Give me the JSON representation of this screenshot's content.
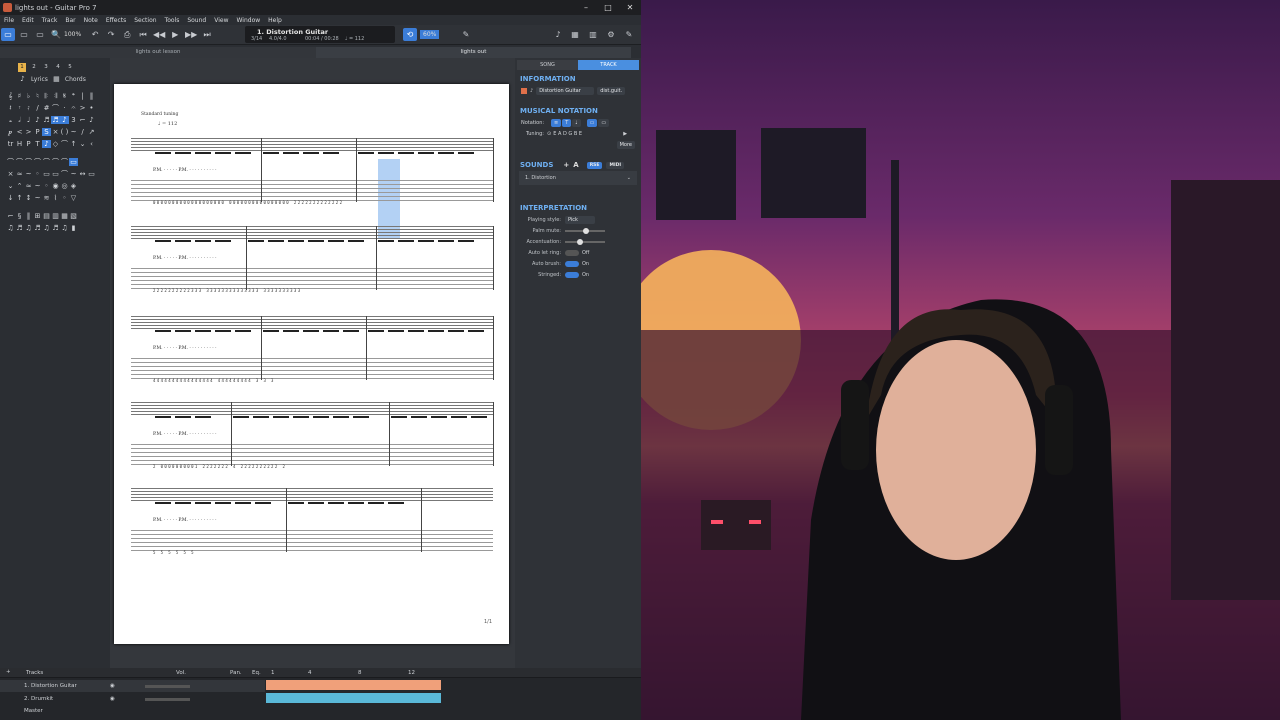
{
  "window": {
    "title": "lights out - Guitar Pro 7",
    "controls": [
      "–",
      "□",
      "✕"
    ]
  },
  "menu": [
    "File",
    "Edit",
    "Track",
    "Bar",
    "Note",
    "Effects",
    "Section",
    "Tools",
    "Sound",
    "View",
    "Window",
    "Help"
  ],
  "toolbar": {
    "zoom": "100%",
    "track_name": "1. Distortion Guitar",
    "bar_pos": "3/14",
    "sig": "4.0/4.0",
    "time": "00:04 / 00:28",
    "tempo": "♩ = 112",
    "countin": "60%"
  },
  "tabs": {
    "left": "lights out lesson",
    "right": "lights out"
  },
  "palette": {
    "numbers": [
      "1",
      "2",
      "3",
      "4",
      "5"
    ],
    "lyrics": "Lyrics",
    "chords": "Chords"
  },
  "score": {
    "tuning": "Standard tuning",
    "tempo": "♩ = 112",
    "page_number": "1/1",
    "track_abbrev": "dist.guit."
  },
  "right": {
    "tabs": [
      "SONG",
      "TRACK"
    ],
    "information": "INFORMATION",
    "track_label": "Distortion Guitar",
    "track_short": "dist.guit.",
    "notation_title": "MUSICAL NOTATION",
    "notation_label": "Notation:",
    "tuning_label": "Tuning:",
    "tuning_value": "E A D G B E",
    "more": "More",
    "sounds_title": "SOUNDS",
    "sounds_btns": [
      "RSE",
      "MIDI"
    ],
    "sound_item": "1. Distortion",
    "interp_title": "INTERPRETATION",
    "playing_style_label": "Playing style:",
    "playing_style": "Pick",
    "palm_mute": "Palm mute:",
    "accentuation": "Accentuation:",
    "auto_let_ring": "Auto let ring:",
    "auto_let_ring_val": "Off",
    "auto_brush": "Auto brush:",
    "auto_brush_val": "On",
    "stringed": "Stringed:",
    "stringed_val": "On"
  },
  "tracks": {
    "header": "Tracks",
    "vol": "Vol.",
    "pan": "Pan.",
    "eq": "Eq.",
    "markers": [
      "1",
      "4",
      "8",
      "12"
    ],
    "rows": [
      "1. Distortion Guitar",
      "2. Drumkit",
      "Master"
    ]
  },
  "colors": {
    "accent": "#3b7dd8",
    "track1": "#f0a07a",
    "track2": "#5ab8d8"
  }
}
